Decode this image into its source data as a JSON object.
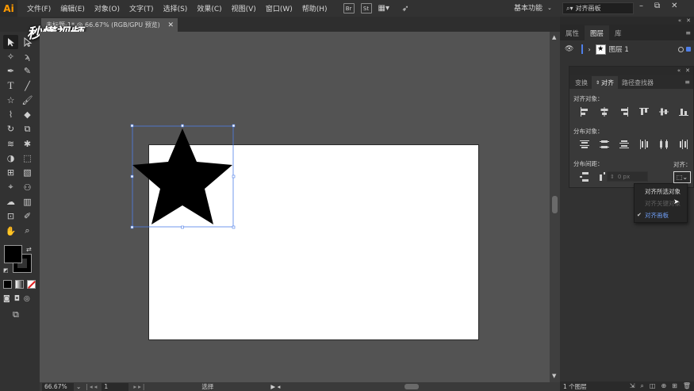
{
  "app": {
    "logo": "Ai",
    "accent": "#ff9a00"
  },
  "menu": {
    "items": [
      "文件(F)",
      "编辑(E)",
      "对象(O)",
      "文字(T)",
      "选择(S)",
      "效果(C)",
      "视图(V)",
      "窗口(W)",
      "帮助(H)"
    ],
    "bridge": "Br",
    "stock": "St",
    "workspace": "基本功能",
    "search_value": "对齐画板"
  },
  "document": {
    "tab_title": "未标题-1* @ 66.67% (RGB/GPU 预览)"
  },
  "watermark": "秒懂视频",
  "statusbar": {
    "zoom": "66.67%",
    "page": "1",
    "tool": "选择"
  },
  "right_panel": {
    "tabs": [
      "属性",
      "图层",
      "库"
    ],
    "active_tab": "图层",
    "layer_name": "图层 1",
    "layer_color": "#4f7fe8",
    "layer_count": "1 个图层"
  },
  "align_panel": {
    "tabs": [
      "变换",
      "对齐",
      "路径查找器"
    ],
    "active_tab": "对齐",
    "align_objects_label": "对齐对象：",
    "distribute_objects_label": "分布对象：",
    "distribute_spacing_label": "分布间距：",
    "align_to_label": "对齐：",
    "spacing_placeholder": "0 px"
  },
  "dropdown": {
    "items": [
      {
        "label": "对齐所选对象",
        "state": "normal"
      },
      {
        "label": "对齐关键对象",
        "state": "disabled"
      },
      {
        "label": "对齐画板",
        "state": "selected"
      }
    ],
    "selected_color": "#6f9ef5"
  }
}
